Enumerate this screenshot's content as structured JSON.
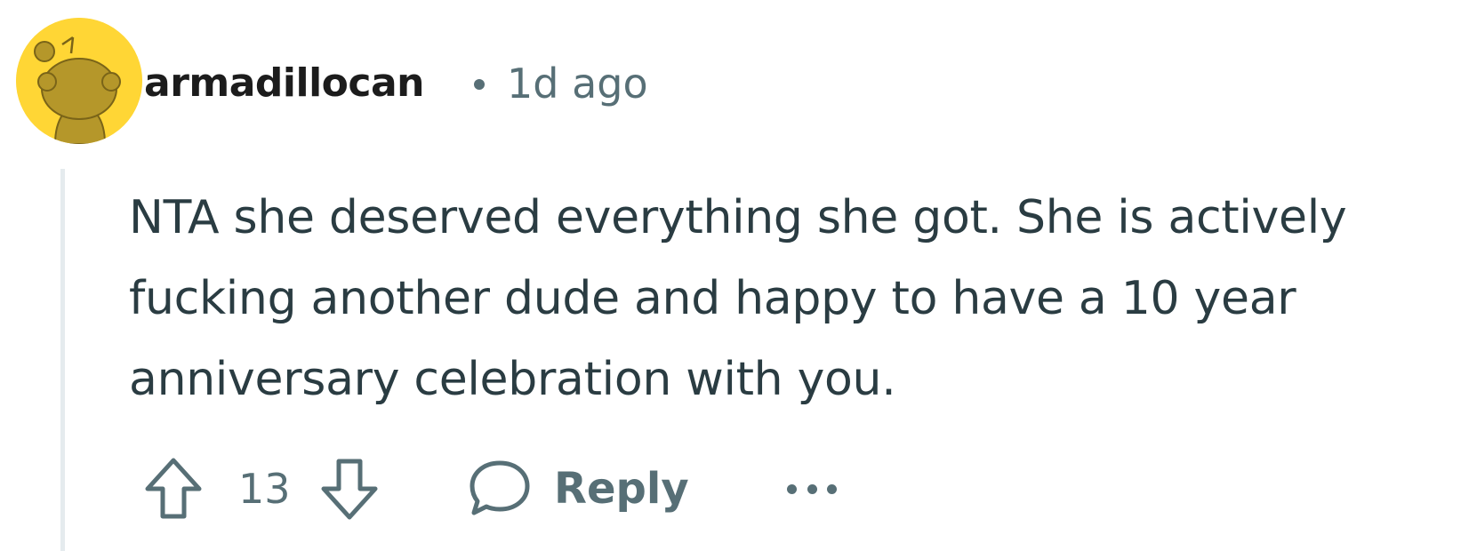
{
  "comment": {
    "author": "armadillocan",
    "separator": "•",
    "timestamp": "1d ago",
    "body": "NTA she deserved everything she got. She is actively fucking another dude and happy to have a 10 year anniversary celebration with you.",
    "avatar": {
      "icon": "snoo-avatar-icon",
      "background": "#ffd635"
    },
    "actions": {
      "upvote_icon": "arrow-up-icon",
      "score": "13",
      "downvote_icon": "arrow-down-icon",
      "reply_icon": "speech-bubble-icon",
      "reply_label": "Reply",
      "more_icon": "ellipsis-icon"
    }
  },
  "colors": {
    "text_primary": "#1c1c1c",
    "text_body": "#2a3c42",
    "text_meta": "#576f76",
    "thread_line": "#e5ebee"
  }
}
